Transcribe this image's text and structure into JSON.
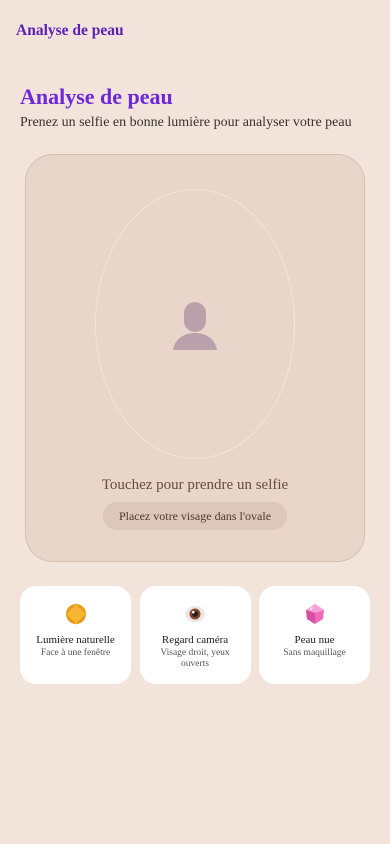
{
  "header": {
    "app_title": "Analyse de peau"
  },
  "main": {
    "title": "Analyse de peau",
    "subtitle": "Prenez un selfie en bonne lumière pour analyser votre peau",
    "capture": {
      "cta": "Touchez pour prendre un selfie",
      "hint": "Placez votre visage dans l'ovale",
      "icon": "person-silhouette-icon"
    },
    "tips": [
      {
        "icon": "sun-icon",
        "title": "Lumière naturelle",
        "desc": "Face à une fenêtre"
      },
      {
        "icon": "eye-icon",
        "title": "Regard caméra",
        "desc": "Visage droit, yeux ouverts"
      },
      {
        "icon": "gem-icon",
        "title": "Peau nue",
        "desc": "Sans maquillage"
      }
    ]
  },
  "colors": {
    "background": "#f2e4da",
    "accent": "#6d28d9",
    "card": "#e9d6ca"
  }
}
